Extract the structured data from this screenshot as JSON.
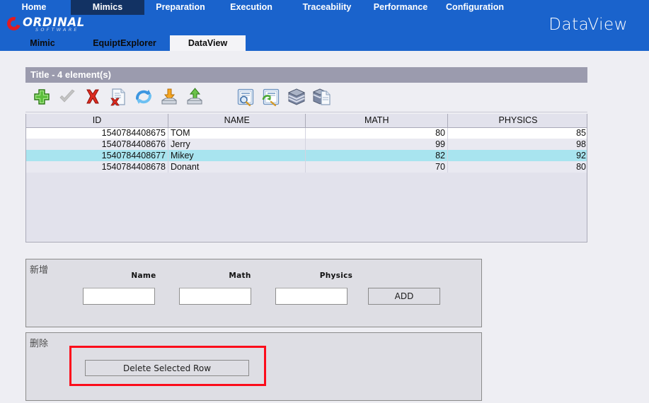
{
  "banner": {
    "logo": {
      "name": "ORDINAL",
      "subtitle": "SOFTWARE"
    },
    "wordmark": "DataView",
    "main_nav": [
      {
        "label": "Home",
        "active": false
      },
      {
        "label": "Mimics",
        "active": true
      },
      {
        "label": "Preparation",
        "active": false
      },
      {
        "label": "Execution",
        "active": false
      },
      {
        "label": "Traceability",
        "active": false
      },
      {
        "label": "Performance",
        "active": false
      },
      {
        "label": "Configuration",
        "active": false
      }
    ],
    "sub_tabs": [
      {
        "label": "Mimic",
        "active": false
      },
      {
        "label": "EquiptExplorer",
        "active": false
      },
      {
        "label": "DataView",
        "active": true
      }
    ]
  },
  "panel": {
    "title": "Title - 4 element(s)",
    "toolbar": [
      {
        "name": "add-row-icon",
        "tooltip": "Add"
      },
      {
        "name": "commit-check-icon",
        "tooltip": "Commit"
      },
      {
        "name": "delete-row-icon",
        "tooltip": "Delete"
      },
      {
        "name": "delete-document-icon",
        "tooltip": "Delete all"
      },
      {
        "name": "refresh-icon",
        "tooltip": "Refresh"
      },
      {
        "name": "import-icon",
        "tooltip": "Import"
      },
      {
        "name": "export-icon",
        "tooltip": "Export"
      },
      {
        "name": "search-document-icon",
        "tooltip": "Query"
      },
      {
        "name": "refresh-query-icon",
        "tooltip": "Re-run query"
      },
      {
        "name": "database-icon",
        "tooltip": "Database"
      },
      {
        "name": "database-copy-icon",
        "tooltip": "Copy database"
      }
    ]
  },
  "table": {
    "columns": [
      "ID",
      "NAME",
      "MATH",
      "PHYSICS"
    ],
    "rows": [
      {
        "id": "1540784408675",
        "name": "TOM",
        "math": "80",
        "physics": "85",
        "selected": false
      },
      {
        "id": "1540784408676",
        "name": "Jerry",
        "math": "99",
        "physics": "98",
        "selected": false
      },
      {
        "id": "1540784408677",
        "name": "Mikey",
        "math": "82",
        "physics": "92",
        "selected": true
      },
      {
        "id": "1540784408678",
        "name": "Donant",
        "math": "70",
        "physics": "80",
        "selected": false
      }
    ]
  },
  "add_panel": {
    "legend": "新增",
    "labels": {
      "name": "Name",
      "math": "Math",
      "physics": "Physics"
    },
    "values": {
      "name": "",
      "math": "",
      "physics": ""
    },
    "add_button": "ADD"
  },
  "delete_panel": {
    "legend": "删除",
    "delete_button": "Delete Selected Row",
    "highlight_color": "#fc0d1b"
  },
  "colors": {
    "banner_blue": "#1a63cc",
    "active_nav": "#123263",
    "title_bar": "#9b9bae",
    "selected_row": "#a8e4ef",
    "page_background": "#eeeef3",
    "panel_background": "#dedee4"
  }
}
